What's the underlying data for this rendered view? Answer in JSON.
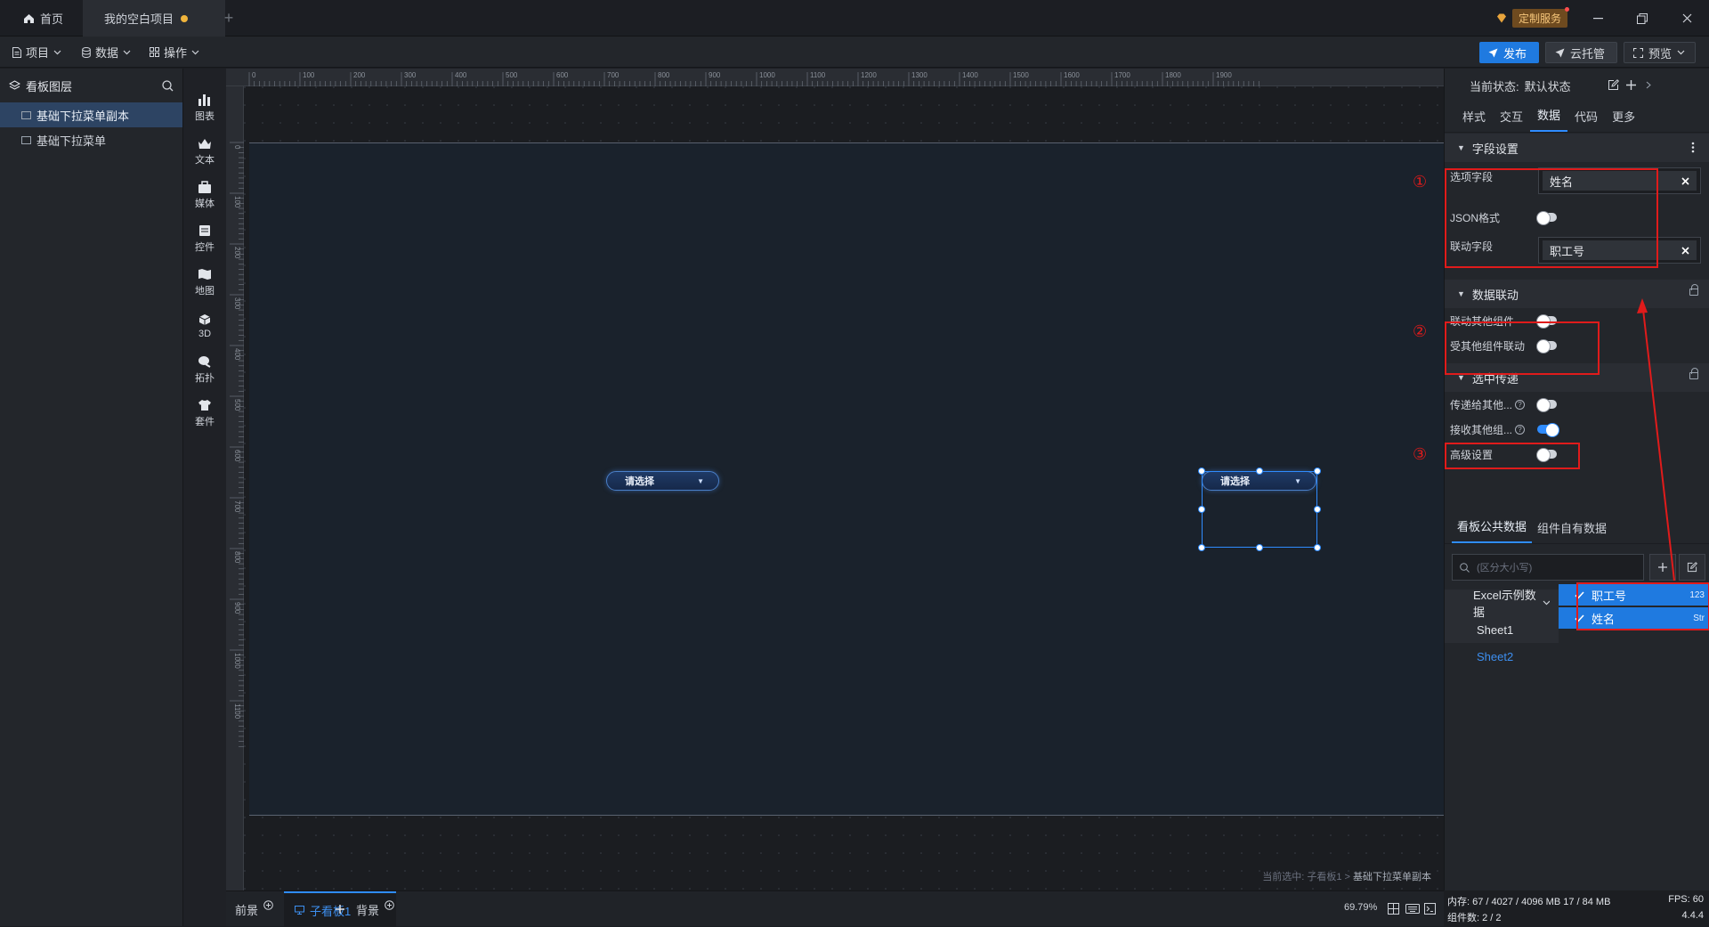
{
  "titlebar": {
    "home_tab": "首页",
    "project_tab": "我的空白项目",
    "custom_service": "定制服务"
  },
  "menubar": {
    "project": "项目",
    "data": "数据",
    "operate": "操作",
    "publish": "发布",
    "cloud_host": "云托管",
    "preview": "预览"
  },
  "layers": {
    "title": "看板图层",
    "items": [
      {
        "label": "基础下拉菜单副本",
        "selected": true
      },
      {
        "label": "基础下拉菜单",
        "selected": false
      }
    ]
  },
  "components": [
    {
      "label": "图表",
      "icon": "chart-icon"
    },
    {
      "label": "文本",
      "icon": "text-icon"
    },
    {
      "label": "媒体",
      "icon": "media-icon"
    },
    {
      "label": "控件",
      "icon": "control-icon"
    },
    {
      "label": "地图",
      "icon": "map-icon"
    },
    {
      "label": "3D",
      "icon": "cube-icon"
    },
    {
      "label": "拓扑",
      "icon": "topology-icon"
    },
    {
      "label": "套件",
      "icon": "kit-icon"
    }
  ],
  "ruler": {
    "top": [
      "0",
      "100",
      "200",
      "300",
      "400",
      "500",
      "600",
      "700",
      "800",
      "900",
      "1000",
      "1100",
      "1200",
      "1300",
      "1400",
      "1500",
      "1600",
      "1700",
      "1800",
      "1900"
    ],
    "left": [
      "0",
      "100",
      "200",
      "300",
      "400",
      "500",
      "600",
      "700",
      "800",
      "900",
      "1000",
      "1100"
    ]
  },
  "canvas": {
    "dropdown1": "请选择",
    "dropdown2": "请选择",
    "breadcrumb_prefix": "当前选中: 子看板1 > ",
    "breadcrumb_current": "基础下拉菜单副本"
  },
  "bottombar": {
    "foreground": "前景",
    "subboard": "子看板1",
    "background": "背景",
    "zoom": "69.79%"
  },
  "panel": {
    "state_label": "当前状态:",
    "state_value": "默认状态",
    "tabs": [
      "样式",
      "交互",
      "数据",
      "代码",
      "更多"
    ],
    "active_tab": "数据",
    "field_settings": {
      "title": "字段设置",
      "option_field_label": "选项字段",
      "option_field_value": "姓名",
      "json_label": "JSON格式",
      "link_field_label": "联动字段",
      "link_field_value": "职工号"
    },
    "data_link": {
      "title": "数据联动",
      "link_others": "联动其他组件",
      "linked_by_others": "受其他组件联动"
    },
    "selection_pass": {
      "title": "选中传递",
      "pass_to_others": "传递给其他...",
      "receive_others": "接收其他组...",
      "advanced": "高级设置"
    },
    "annotations": [
      "①",
      "②",
      "③"
    ],
    "data_tabs": [
      "看板公共数据",
      "组件自有数据"
    ],
    "search_placeholder": "(区分大小写)",
    "tree": [
      {
        "label": "Excel示例数据"
      },
      {
        "label": "Sheet1"
      },
      {
        "label": "Sheet2"
      }
    ],
    "fields": [
      {
        "label": "职工号",
        "type": "123"
      },
      {
        "label": "姓名",
        "type": "Str"
      }
    ]
  },
  "status": {
    "memory": "内存:  67 / 4027 / 4096 MB  17 / 84 MB",
    "fps": "FPS:  60",
    "count": "组件数: 2 / 2",
    "version": "4.4.4"
  },
  "colors": {
    "accent": "#2f8cff",
    "annotation_red": "#e01b1b",
    "publish_btn": "#1f7ae0",
    "panel_bg": "#23262b",
    "board_bg": "#1a222c"
  }
}
